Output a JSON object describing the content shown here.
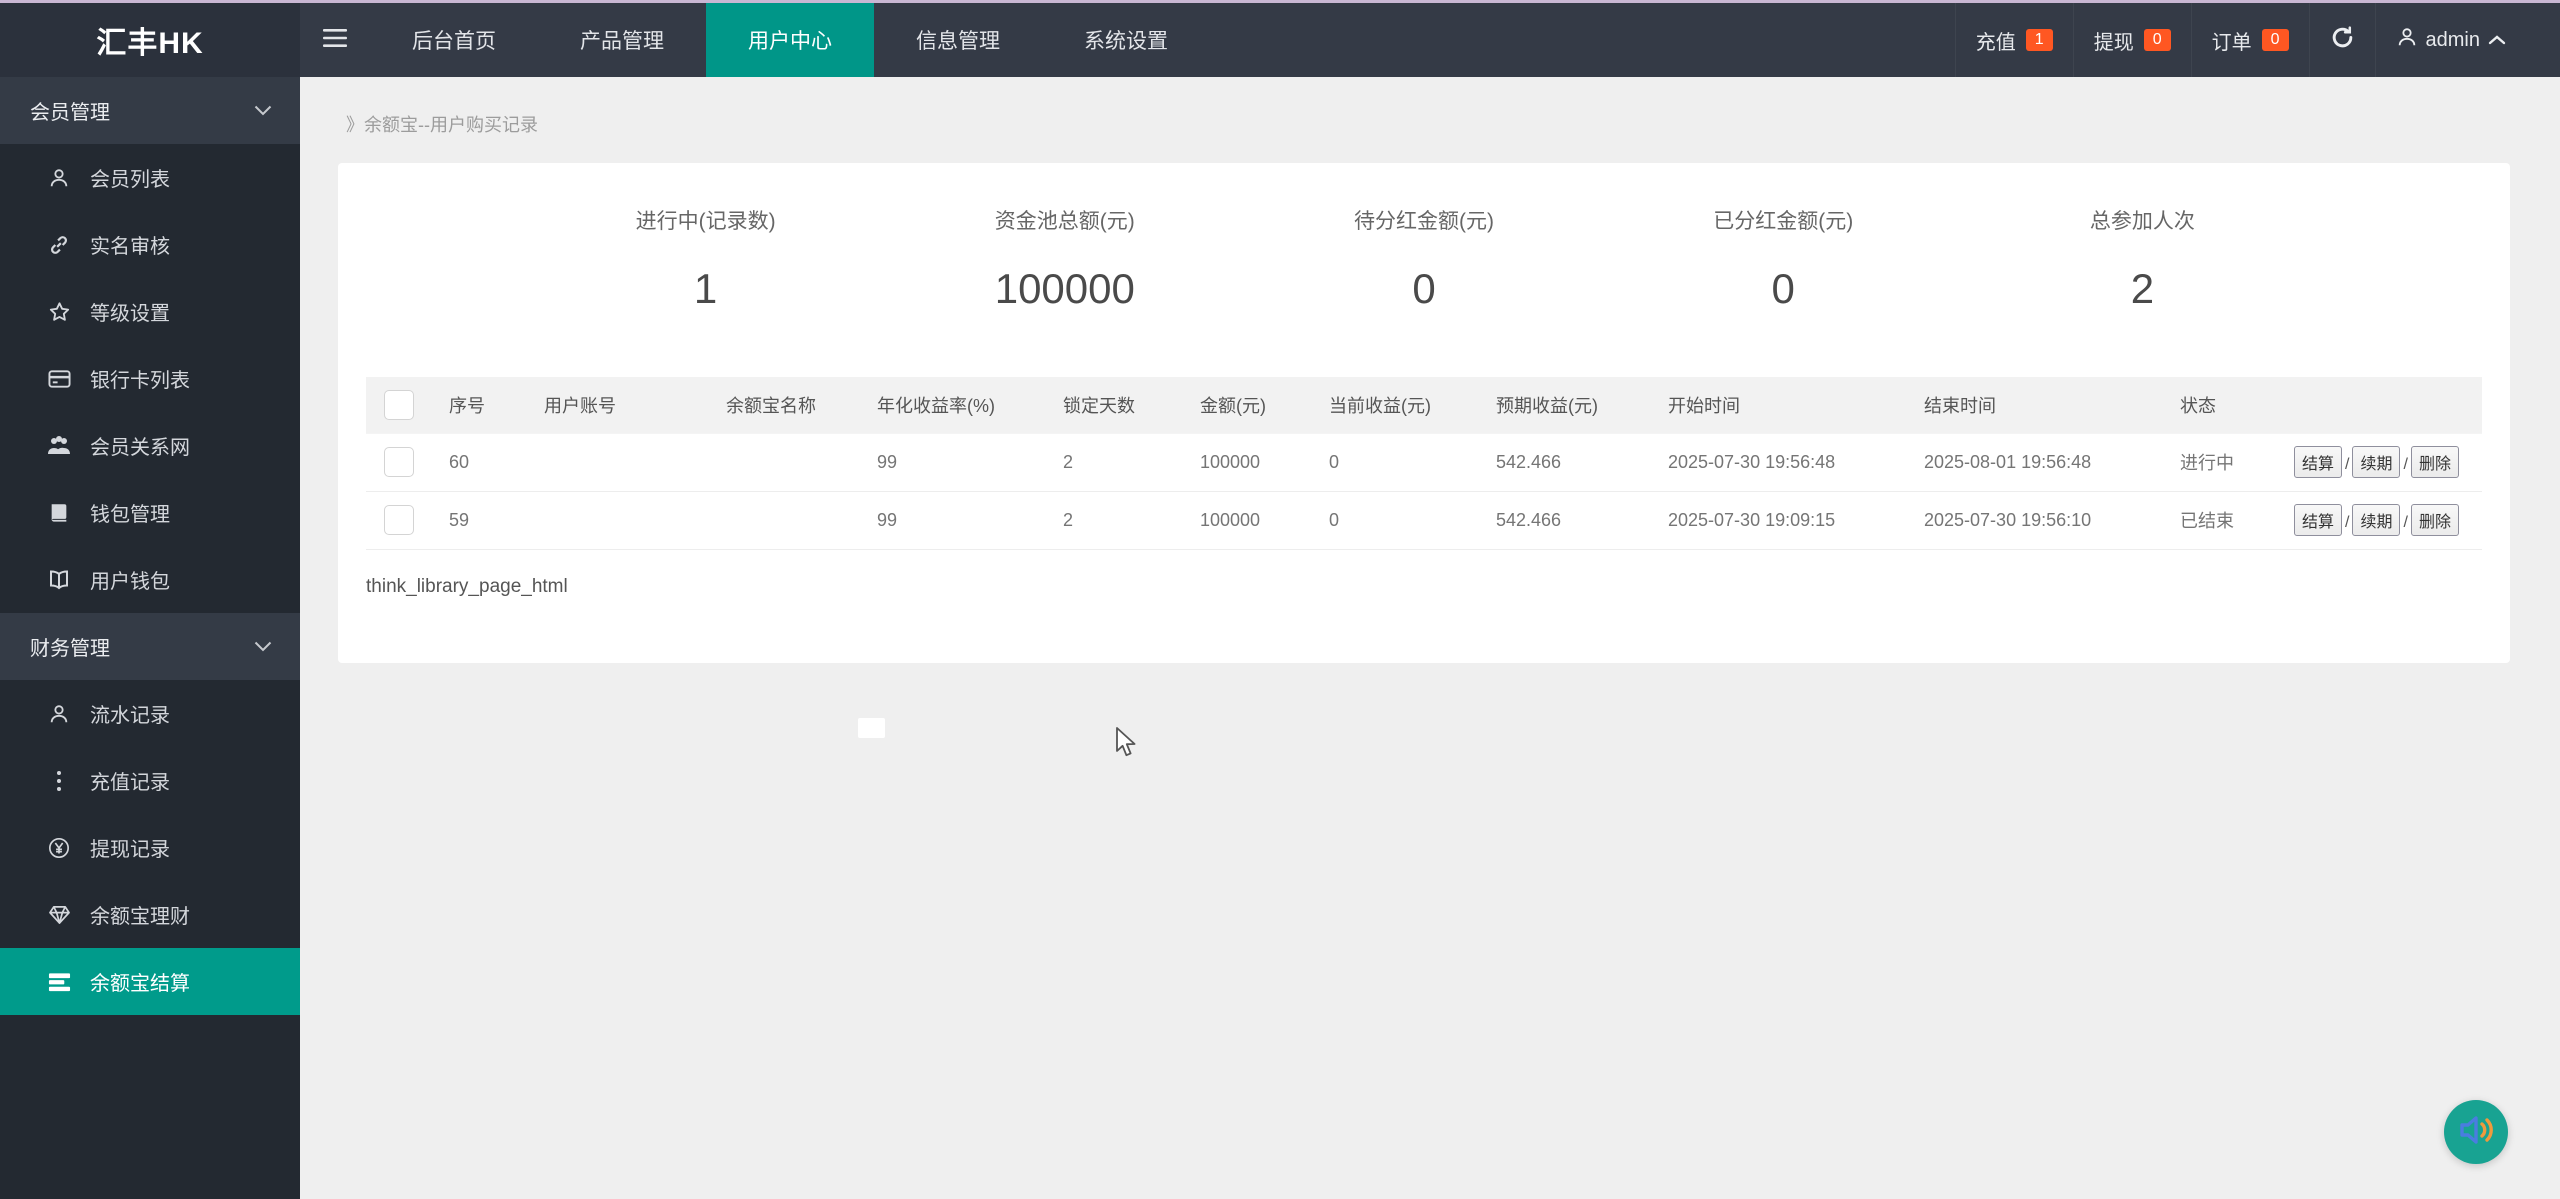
{
  "colors": {
    "accent": "#009688",
    "badge": "#ff5722",
    "header_bg": "#343a46",
    "logo_bg": "#2b313c",
    "sidebar_bg": "#232931",
    "sidebar_header_bg": "#343b46",
    "sidebar_active_bg": "#009b8b",
    "page_bg": "#efefef",
    "fab_bg": "#18a392",
    "top_strip": "#c9b7d3"
  },
  "header": {
    "logo": "汇丰HK",
    "nav": [
      {
        "label": "后台首页"
      },
      {
        "label": "产品管理"
      },
      {
        "label": "用户中心",
        "active": true
      },
      {
        "label": "信息管理"
      },
      {
        "label": "系统设置"
      }
    ],
    "quick": [
      {
        "label": "充值",
        "count": "1"
      },
      {
        "label": "提现",
        "count": "0"
      },
      {
        "label": "订单",
        "count": "0"
      }
    ],
    "user": "admin"
  },
  "icons": {
    "hamburger": "three-bars",
    "refresh": "circular-arrow",
    "chevron_up": "∧",
    "chevron_down": "∨",
    "user": "person-outline",
    "link": "chain",
    "star": "star-outline",
    "credit_card": "card",
    "users": "group",
    "book": "closed-book",
    "open_book": "open-book",
    "ellipsis": "vertical-dots",
    "yen": "¥-in-circle",
    "gem": "diamond",
    "list": "stacked-bars",
    "speaker": "audio-speaker"
  },
  "sidebar": {
    "items": [
      {
        "label": "会员管理",
        "type": "header"
      },
      {
        "label": "会员列表",
        "type": "item"
      },
      {
        "label": "实名审核",
        "type": "item"
      },
      {
        "label": "等级设置",
        "type": "item"
      },
      {
        "label": "银行卡列表",
        "type": "item"
      },
      {
        "label": "会员关系网",
        "type": "item"
      },
      {
        "label": "钱包管理",
        "type": "item"
      },
      {
        "label": "用户钱包",
        "type": "item"
      },
      {
        "label": "财务管理",
        "type": "header"
      },
      {
        "label": "流水记录",
        "type": "item"
      },
      {
        "label": "充值记录",
        "type": "item"
      },
      {
        "label": "提现记录",
        "type": "item"
      },
      {
        "label": "余额宝理财",
        "type": "item"
      },
      {
        "label": "余额宝结算",
        "type": "active"
      }
    ]
  },
  "breadcrumb": "》余额宝--用户购买记录",
  "stats": [
    {
      "label": "进行中(记录数)",
      "value": "1"
    },
    {
      "label": "资金池总额(元)",
      "value": "100000"
    },
    {
      "label": "待分红金额(元)",
      "value": "0"
    },
    {
      "label": "已分红金额(元)",
      "value": "0"
    },
    {
      "label": "总参加人次",
      "value": "2"
    }
  ],
  "table": {
    "headers": [
      "序号",
      "用户账号",
      "余额宝名称",
      "年化收益率(%)",
      "锁定天数",
      "金额(元)",
      "当前收益(元)",
      "预期收益(元)",
      "开始时间",
      "结束时间",
      "状态"
    ],
    "action_labels": [
      "结算",
      "续期",
      "删除"
    ],
    "action_separator": "/",
    "rows": [
      [
        "60",
        "",
        "",
        "99",
        "2",
        "100000",
        "0",
        "542.466",
        "2025-07-30 19:56:48",
        "2025-08-01 19:56:48",
        "进行中"
      ],
      [
        "59",
        "",
        "",
        "99",
        "2",
        "100000",
        "0",
        "542.466",
        "2025-07-30 19:09:15",
        "2025-07-30 19:56:10",
        "已结束"
      ]
    ]
  },
  "footer_note": "think_library_page_html"
}
